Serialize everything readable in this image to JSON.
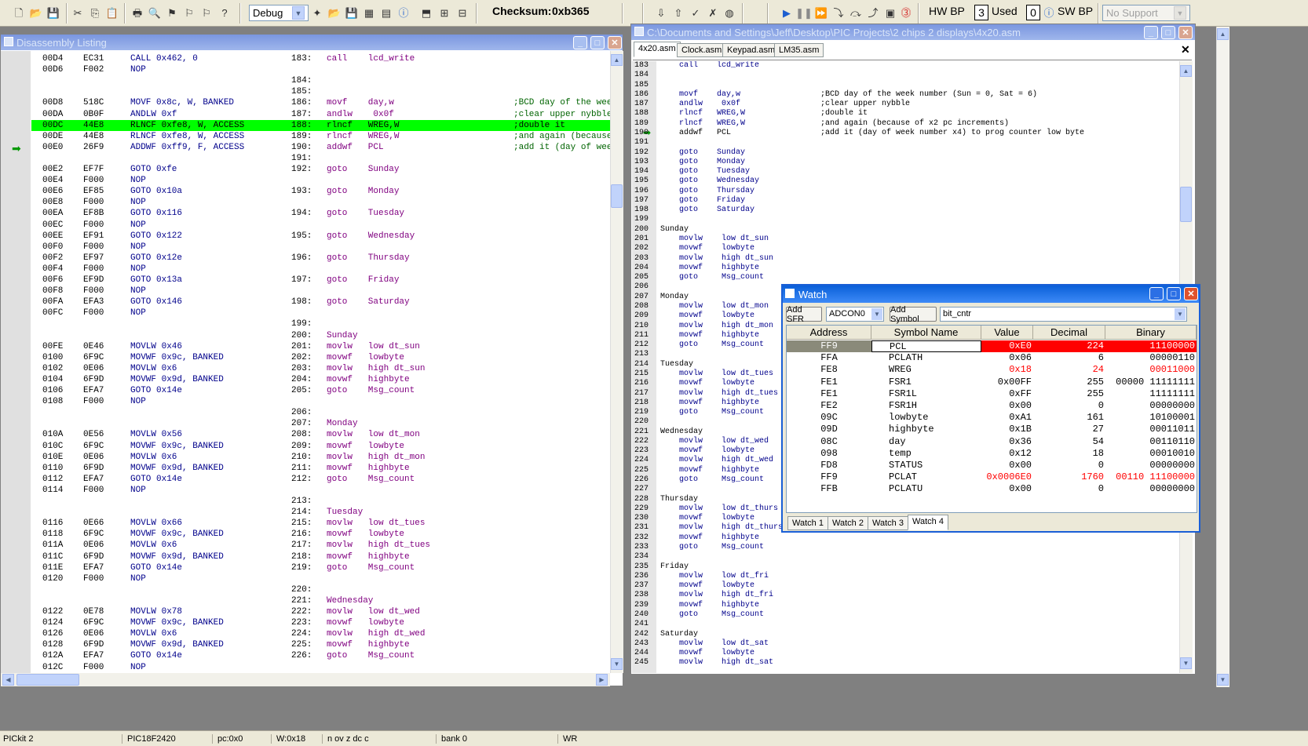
{
  "toolbar": {
    "config_value": "Debug",
    "checksum_label": "Checksum:",
    "checksum_value": "0xb365",
    "hw_bp_label": "HW BP",
    "hw_bp_used_count": "3",
    "used_label": "Used",
    "sw_bp_count": "0",
    "sw_bp_label": "SW BP",
    "support_value": "No Support"
  },
  "disassembly": {
    "title": "Disassembly Listing",
    "current_row": 6,
    "rows": [
      {
        "addr": "00D4",
        "op": "EC31",
        "ins": "CALL 0x462, 0",
        "ln": "183:",
        "src": "call    lcd_write",
        "cmt": ""
      },
      {
        "addr": "00D6",
        "op": "F002",
        "ins": "NOP",
        "ln": "",
        "src": "",
        "cmt": ""
      },
      {
        "addr": "",
        "op": "",
        "ins": "",
        "ln": "184:",
        "src": "",
        "cmt": ""
      },
      {
        "addr": "",
        "op": "",
        "ins": "",
        "ln": "185:",
        "src": "",
        "cmt": ""
      },
      {
        "addr": "00D8",
        "op": "518C",
        "ins": "MOVF 0x8c, W, BANKED",
        "ln": "186:",
        "src": "movf    day,w",
        "cmt": ";BCD day of the wee"
      },
      {
        "addr": "00DA",
        "op": "0B0F",
        "ins": "ANDLW 0xf",
        "ln": "187:",
        "src": "andlw    0x0f",
        "cmt": ";clear upper nybble"
      },
      {
        "addr": "00DC",
        "op": "44E8",
        "ins": "RLNCF 0xfe8, W, ACCESS",
        "ln": "188:",
        "src": "rlncf   WREG,W",
        "cmt": ";double it"
      },
      {
        "addr": "00DE",
        "op": "44E8",
        "ins": "RLNCF 0xfe8, W, ACCESS",
        "ln": "189:",
        "src": "rlncf   WREG,W",
        "cmt": ";and again (because"
      },
      {
        "addr": "00E0",
        "op": "26F9",
        "ins": "ADDWF 0xff9, F, ACCESS",
        "ln": "190:",
        "src": "addwf   PCL",
        "cmt": ";add it (day of wee"
      },
      {
        "addr": "",
        "op": "",
        "ins": "",
        "ln": "191:",
        "src": "",
        "cmt": ""
      },
      {
        "addr": "00E2",
        "op": "EF7F",
        "ins": "GOTO 0xfe",
        "ln": "192:",
        "src": "goto    Sunday",
        "cmt": ""
      },
      {
        "addr": "00E4",
        "op": "F000",
        "ins": "NOP",
        "ln": "",
        "src": "",
        "cmt": ""
      },
      {
        "addr": "00E6",
        "op": "EF85",
        "ins": "GOTO 0x10a",
        "ln": "193:",
        "src": "goto    Monday",
        "cmt": ""
      },
      {
        "addr": "00E8",
        "op": "F000",
        "ins": "NOP",
        "ln": "",
        "src": "",
        "cmt": ""
      },
      {
        "addr": "00EA",
        "op": "EF8B",
        "ins": "GOTO 0x116",
        "ln": "194:",
        "src": "goto    Tuesday",
        "cmt": ""
      },
      {
        "addr": "00EC",
        "op": "F000",
        "ins": "NOP",
        "ln": "",
        "src": "",
        "cmt": ""
      },
      {
        "addr": "00EE",
        "op": "EF91",
        "ins": "GOTO 0x122",
        "ln": "195:",
        "src": "goto    Wednesday",
        "cmt": ""
      },
      {
        "addr": "00F0",
        "op": "F000",
        "ins": "NOP",
        "ln": "",
        "src": "",
        "cmt": ""
      },
      {
        "addr": "00F2",
        "op": "EF97",
        "ins": "GOTO 0x12e",
        "ln": "196:",
        "src": "goto    Thursday",
        "cmt": ""
      },
      {
        "addr": "00F4",
        "op": "F000",
        "ins": "NOP",
        "ln": "",
        "src": "",
        "cmt": ""
      },
      {
        "addr": "00F6",
        "op": "EF9D",
        "ins": "GOTO 0x13a",
        "ln": "197:",
        "src": "goto    Friday",
        "cmt": ""
      },
      {
        "addr": "00F8",
        "op": "F000",
        "ins": "NOP",
        "ln": "",
        "src": "",
        "cmt": ""
      },
      {
        "addr": "00FA",
        "op": "EFA3",
        "ins": "GOTO 0x146",
        "ln": "198:",
        "src": "goto    Saturday",
        "cmt": ""
      },
      {
        "addr": "00FC",
        "op": "F000",
        "ins": "NOP",
        "ln": "",
        "src": "",
        "cmt": ""
      },
      {
        "addr": "",
        "op": "",
        "ins": "",
        "ln": "199:",
        "src": "",
        "cmt": ""
      },
      {
        "addr": "",
        "op": "",
        "ins": "",
        "ln": "200:",
        "src": "Sunday",
        "cmt": ""
      },
      {
        "addr": "00FE",
        "op": "0E46",
        "ins": "MOVLW 0x46",
        "ln": "201:",
        "src": "movlw   low dt_sun",
        "cmt": ""
      },
      {
        "addr": "0100",
        "op": "6F9C",
        "ins": "MOVWF 0x9c, BANKED",
        "ln": "202:",
        "src": "movwf   lowbyte",
        "cmt": ""
      },
      {
        "addr": "0102",
        "op": "0E06",
        "ins": "MOVLW 0x6",
        "ln": "203:",
        "src": "movlw   high dt_sun",
        "cmt": ""
      },
      {
        "addr": "0104",
        "op": "6F9D",
        "ins": "MOVWF 0x9d, BANKED",
        "ln": "204:",
        "src": "movwf   highbyte",
        "cmt": ""
      },
      {
        "addr": "0106",
        "op": "EFA7",
        "ins": "GOTO 0x14e",
        "ln": "205:",
        "src": "goto    Msg_count",
        "cmt": ""
      },
      {
        "addr": "0108",
        "op": "F000",
        "ins": "NOP",
        "ln": "",
        "src": "",
        "cmt": ""
      },
      {
        "addr": "",
        "op": "",
        "ins": "",
        "ln": "206:",
        "src": "",
        "cmt": ""
      },
      {
        "addr": "",
        "op": "",
        "ins": "",
        "ln": "207:",
        "src": "Monday",
        "cmt": ""
      },
      {
        "addr": "010A",
        "op": "0E56",
        "ins": "MOVLW 0x56",
        "ln": "208:",
        "src": "movlw   low dt_mon",
        "cmt": ""
      },
      {
        "addr": "010C",
        "op": "6F9C",
        "ins": "MOVWF 0x9c, BANKED",
        "ln": "209:",
        "src": "movwf   lowbyte",
        "cmt": ""
      },
      {
        "addr": "010E",
        "op": "0E06",
        "ins": "MOVLW 0x6",
        "ln": "210:",
        "src": "movlw   high dt_mon",
        "cmt": ""
      },
      {
        "addr": "0110",
        "op": "6F9D",
        "ins": "MOVWF 0x9d, BANKED",
        "ln": "211:",
        "src": "movwf   highbyte",
        "cmt": ""
      },
      {
        "addr": "0112",
        "op": "EFA7",
        "ins": "GOTO 0x14e",
        "ln": "212:",
        "src": "goto    Msg_count",
        "cmt": ""
      },
      {
        "addr": "0114",
        "op": "F000",
        "ins": "NOP",
        "ln": "",
        "src": "",
        "cmt": ""
      },
      {
        "addr": "",
        "op": "",
        "ins": "",
        "ln": "213:",
        "src": "",
        "cmt": ""
      },
      {
        "addr": "",
        "op": "",
        "ins": "",
        "ln": "214:",
        "src": "Tuesday",
        "cmt": ""
      },
      {
        "addr": "0116",
        "op": "0E66",
        "ins": "MOVLW 0x66",
        "ln": "215:",
        "src": "movlw   low dt_tues",
        "cmt": ""
      },
      {
        "addr": "0118",
        "op": "6F9C",
        "ins": "MOVWF 0x9c, BANKED",
        "ln": "216:",
        "src": "movwf   lowbyte",
        "cmt": ""
      },
      {
        "addr": "011A",
        "op": "0E06",
        "ins": "MOVLW 0x6",
        "ln": "217:",
        "src": "movlw   high dt_tues",
        "cmt": ""
      },
      {
        "addr": "011C",
        "op": "6F9D",
        "ins": "MOVWF 0x9d, BANKED",
        "ln": "218:",
        "src": "movwf   highbyte",
        "cmt": ""
      },
      {
        "addr": "011E",
        "op": "EFA7",
        "ins": "GOTO 0x14e",
        "ln": "219:",
        "src": "goto    Msg_count",
        "cmt": ""
      },
      {
        "addr": "0120",
        "op": "F000",
        "ins": "NOP",
        "ln": "",
        "src": "",
        "cmt": ""
      },
      {
        "addr": "",
        "op": "",
        "ins": "",
        "ln": "220:",
        "src": "",
        "cmt": ""
      },
      {
        "addr": "",
        "op": "",
        "ins": "",
        "ln": "221:",
        "src": "Wednesday",
        "cmt": ""
      },
      {
        "addr": "0122",
        "op": "0E78",
        "ins": "MOVLW 0x78",
        "ln": "222:",
        "src": "movlw   low dt_wed",
        "cmt": ""
      },
      {
        "addr": "0124",
        "op": "6F9C",
        "ins": "MOVWF 0x9c, BANKED",
        "ln": "223:",
        "src": "movwf   lowbyte",
        "cmt": ""
      },
      {
        "addr": "0126",
        "op": "0E06",
        "ins": "MOVLW 0x6",
        "ln": "224:",
        "src": "movlw   high dt_wed",
        "cmt": ""
      },
      {
        "addr": "0128",
        "op": "6F9D",
        "ins": "MOVWF 0x9d, BANKED",
        "ln": "225:",
        "src": "movwf   highbyte",
        "cmt": ""
      },
      {
        "addr": "012A",
        "op": "EFA7",
        "ins": "GOTO 0x14e",
        "ln": "226:",
        "src": "goto    Msg_count",
        "cmt": ""
      },
      {
        "addr": "012C",
        "op": "F000",
        "ins": "NOP",
        "ln": "",
        "src": "",
        "cmt": ""
      }
    ]
  },
  "source": {
    "title": "C:\\Documents and Settings\\Jeff\\Desktop\\PIC Projects\\2 chips 2 displays\\4x20.asm",
    "tabs": [
      "4x20.asm",
      "Clock.asm",
      "Keypad.asm",
      "LM35.asm"
    ],
    "current_line": "190",
    "lines": [
      {
        "n": "183",
        "code": "    call    lcd_write",
        "cmt": ""
      },
      {
        "n": "184",
        "code": "",
        "cmt": ""
      },
      {
        "n": "185",
        "code": "",
        "cmt": ""
      },
      {
        "n": "186",
        "code": "    movf    day,w",
        "cmt": ";BCD day of the week number (Sun = 0, Sat = 6)"
      },
      {
        "n": "187",
        "code": "    andlw    0x0f",
        "cmt": ";clear upper nybble"
      },
      {
        "n": "188",
        "code": "    rlncf   WREG,W",
        "cmt": ";double it"
      },
      {
        "n": "189",
        "code": "    rlncf   WREG,W",
        "cmt": ";and again (because of x2 pc increments)"
      },
      {
        "n": "190",
        "code": "    addwf   PCL",
        "cmt": ";add it (day of week number x4) to prog counter low byte"
      },
      {
        "n": "191",
        "code": "",
        "cmt": ""
      },
      {
        "n": "192",
        "code": "    goto    Sunday",
        "cmt": ""
      },
      {
        "n": "193",
        "code": "    goto    Monday",
        "cmt": ""
      },
      {
        "n": "194",
        "code": "    goto    Tuesday",
        "cmt": ""
      },
      {
        "n": "195",
        "code": "    goto    Wednesday",
        "cmt": ""
      },
      {
        "n": "196",
        "code": "    goto    Thursday",
        "cmt": ""
      },
      {
        "n": "197",
        "code": "    goto    Friday",
        "cmt": ""
      },
      {
        "n": "198",
        "code": "    goto    Saturday",
        "cmt": ""
      },
      {
        "n": "199",
        "code": "",
        "cmt": ""
      },
      {
        "n": "200",
        "code": "Sunday",
        "cmt": ""
      },
      {
        "n": "201",
        "code": "    movlw    low dt_sun",
        "cmt": ""
      },
      {
        "n": "202",
        "code": "    movwf    lowbyte",
        "cmt": ""
      },
      {
        "n": "203",
        "code": "    movlw    high dt_sun",
        "cmt": ""
      },
      {
        "n": "204",
        "code": "    movwf    highbyte",
        "cmt": ""
      },
      {
        "n": "205",
        "code": "    goto     Msg_count",
        "cmt": ""
      },
      {
        "n": "206",
        "code": "",
        "cmt": ""
      },
      {
        "n": "207",
        "code": "Monday",
        "cmt": ""
      },
      {
        "n": "208",
        "code": "    movlw    low dt_mon",
        "cmt": ""
      },
      {
        "n": "209",
        "code": "    movwf    lowbyte",
        "cmt": ""
      },
      {
        "n": "210",
        "code": "    movlw    high dt_mon",
        "cmt": ""
      },
      {
        "n": "211",
        "code": "    movwf    highbyte",
        "cmt": ""
      },
      {
        "n": "212",
        "code": "    goto     Msg_count",
        "cmt": ""
      },
      {
        "n": "213",
        "code": "",
        "cmt": ""
      },
      {
        "n": "214",
        "code": "Tuesday",
        "cmt": ""
      },
      {
        "n": "215",
        "code": "    movlw    low dt_tues",
        "cmt": ""
      },
      {
        "n": "216",
        "code": "    movwf    lowbyte",
        "cmt": ""
      },
      {
        "n": "217",
        "code": "    movlw    high dt_tues",
        "cmt": ""
      },
      {
        "n": "218",
        "code": "    movwf    highbyte",
        "cmt": ""
      },
      {
        "n": "219",
        "code": "    goto     Msg_count",
        "cmt": ""
      },
      {
        "n": "220",
        "code": "",
        "cmt": ""
      },
      {
        "n": "221",
        "code": "Wednesday",
        "cmt": ""
      },
      {
        "n": "222",
        "code": "    movlw    low dt_wed",
        "cmt": ""
      },
      {
        "n": "223",
        "code": "    movwf    lowbyte",
        "cmt": ""
      },
      {
        "n": "224",
        "code": "    movlw    high dt_wed",
        "cmt": ""
      },
      {
        "n": "225",
        "code": "    movwf    highbyte",
        "cmt": ""
      },
      {
        "n": "226",
        "code": "    goto     Msg_count",
        "cmt": ""
      },
      {
        "n": "227",
        "code": "",
        "cmt": ""
      },
      {
        "n": "228",
        "code": "Thursday",
        "cmt": ""
      },
      {
        "n": "229",
        "code": "    movlw    low dt_thurs",
        "cmt": ""
      },
      {
        "n": "230",
        "code": "    movwf    lowbyte",
        "cmt": ""
      },
      {
        "n": "231",
        "code": "    movlw    high dt_thurs",
        "cmt": ""
      },
      {
        "n": "232",
        "code": "    movwf    highbyte",
        "cmt": ""
      },
      {
        "n": "233",
        "code": "    goto     Msg_count",
        "cmt": ""
      },
      {
        "n": "234",
        "code": "",
        "cmt": ""
      },
      {
        "n": "235",
        "code": "Friday",
        "cmt": ""
      },
      {
        "n": "236",
        "code": "    movlw    low dt_fri",
        "cmt": ""
      },
      {
        "n": "237",
        "code": "    movwf    lowbyte",
        "cmt": ""
      },
      {
        "n": "238",
        "code": "    movlw    high dt_fri",
        "cmt": ""
      },
      {
        "n": "239",
        "code": "    movwf    highbyte",
        "cmt": ""
      },
      {
        "n": "240",
        "code": "    goto     Msg_count",
        "cmt": ""
      },
      {
        "n": "241",
        "code": "",
        "cmt": ""
      },
      {
        "n": "242",
        "code": "Saturday",
        "cmt": ""
      },
      {
        "n": "243",
        "code": "    movlw    low dt_sat",
        "cmt": ""
      },
      {
        "n": "244",
        "code": "    movwf    lowbyte",
        "cmt": ""
      },
      {
        "n": "245",
        "code": "    movlw    high dt_sat",
        "cmt": ""
      }
    ]
  },
  "watch": {
    "title": "Watch",
    "add_sfr_label": "Add SFR",
    "sfr_select_value": "ADCON0",
    "add_symbol_label": "Add Symbol",
    "symbol_select_value": "bit_cntr",
    "columns": [
      "Address",
      "Symbol Name",
      "Value",
      "Decimal",
      "Binary"
    ],
    "rows": [
      {
        "addr": "FF9",
        "sym": "PCL",
        "val": "0xE0",
        "dec": "224",
        "bin": "11100000",
        "state": "selected"
      },
      {
        "addr": "FFA",
        "sym": "PCLATH",
        "val": "0x06",
        "dec": "6",
        "bin": "00000110",
        "state": "normal"
      },
      {
        "addr": "FE8",
        "sym": "WREG",
        "val": "0x18",
        "dec": "24",
        "bin": "00011000",
        "state": "changed"
      },
      {
        "addr": "FE1",
        "sym": "FSR1",
        "val": "0x00FF",
        "dec": "255",
        "bin": "00000 11111111",
        "state": "normal"
      },
      {
        "addr": "FE1",
        "sym": "FSR1L",
        "val": "0xFF",
        "dec": "255",
        "bin": "11111111",
        "state": "normal"
      },
      {
        "addr": "FE2",
        "sym": "FSR1H",
        "val": "0x00",
        "dec": "0",
        "bin": "00000000",
        "state": "normal"
      },
      {
        "addr": "09C",
        "sym": "lowbyte",
        "val": "0xA1",
        "dec": "161",
        "bin": "10100001",
        "state": "normal"
      },
      {
        "addr": "09D",
        "sym": "highbyte",
        "val": "0x1B",
        "dec": "27",
        "bin": "00011011",
        "state": "normal"
      },
      {
        "addr": "08C",
        "sym": "day",
        "val": "0x36",
        "dec": "54",
        "bin": "00110110",
        "state": "normal"
      },
      {
        "addr": "098",
        "sym": "temp",
        "val": "0x12",
        "dec": "18",
        "bin": "00010010",
        "state": "normal"
      },
      {
        "addr": "FD8",
        "sym": "STATUS",
        "val": "0x00",
        "dec": "0",
        "bin": "00000000",
        "state": "normal"
      },
      {
        "addr": "FF9",
        "sym": "PCLAT",
        "val": "0x0006E0",
        "dec": "1760",
        "bin": "00110 11100000",
        "state": "changed"
      },
      {
        "addr": "FFB",
        "sym": "PCLATU",
        "val": "0x00",
        "dec": "0",
        "bin": "00000000",
        "state": "normal"
      }
    ],
    "tabs": [
      "Watch 1",
      "Watch 2",
      "Watch 3",
      "Watch 4"
    ]
  },
  "statusbar": {
    "tool": "PICkit 2",
    "device": "PIC18F2420",
    "pc": "pc:0x0",
    "w": "W:0x18",
    "flags": "n ov z dc c",
    "bank": "bank 0",
    "mode": "WR"
  },
  "colors": {
    "current_line": "#00ff00",
    "changed_value": "#ff0000",
    "selected_row": "#ff0000"
  }
}
